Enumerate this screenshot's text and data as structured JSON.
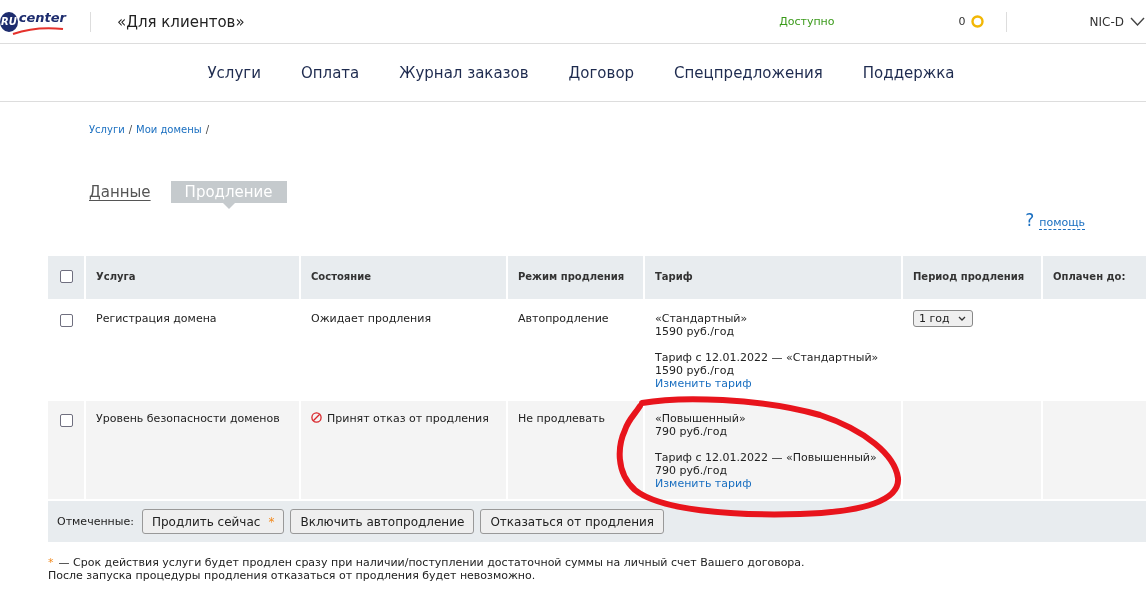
{
  "header": {
    "logo": {
      "badge": "RU",
      "text": "center"
    },
    "title": "«Для клиентов»",
    "balance_label": "Доступно",
    "bonus_count": "0",
    "account": "NIC-D"
  },
  "nav": [
    "Услуги",
    "Оплата",
    "Журнал заказов",
    "Договор",
    "Спецпредложения",
    "Поддержка"
  ],
  "breadcrumbs": {
    "items": [
      "Услуги",
      "Мои домены"
    ],
    "separator": "/"
  },
  "tabs": [
    {
      "label": "Данные",
      "selected": false
    },
    {
      "label": "Продление",
      "selected": true
    }
  ],
  "help": {
    "icon": "?",
    "label": "помощь"
  },
  "table": {
    "header_checkbox": {
      "checked": false
    },
    "columns": [
      "Услуга",
      "Состояние",
      "Режим продления",
      "Тариф",
      "Период продления",
      "Оплачен до:"
    ],
    "rows": [
      {
        "checked": false,
        "service": "Регистрация домена",
        "status": {
          "text": "Ожидает продления",
          "declined": false
        },
        "mode": "Автопродление",
        "tariff": {
          "current": "«Стандартный»",
          "current_price": "1590 руб./год",
          "next": "Тариф с 12.01.2022 — «Стандартный»",
          "next_price": "1590 руб./год",
          "change_link": "Изменить тариф"
        },
        "period": "1 год"
      },
      {
        "checked": false,
        "service": "Уровень безопасности доменов",
        "status": {
          "text": "Принят отказ от продления",
          "declined": true
        },
        "mode": "Не продлевать",
        "tariff": {
          "current": "«Повышенный»",
          "current_price": "790 руб./год",
          "next": "Тариф с 12.01.2022 — «Повышенный»",
          "next_price": "790 руб./год",
          "change_link": "Изменить тариф"
        }
      }
    ]
  },
  "actions": {
    "label": "Отмеченные:",
    "buttons": [
      {
        "label": "Продлить сейчас",
        "note": "*"
      },
      {
        "label": "Включить автопродление"
      },
      {
        "label": "Отказаться от продления"
      }
    ]
  },
  "footnote": {
    "mark": "*",
    "lines": [
      "— Срок действия услуги будет продлен сразу при наличии/поступлении достаточной суммы на личный счет Вашего договора.",
      "После запуска процедуры продления отказаться от продления будет невозможно."
    ]
  },
  "annotation": {
    "kind": "freehand-circle"
  }
}
